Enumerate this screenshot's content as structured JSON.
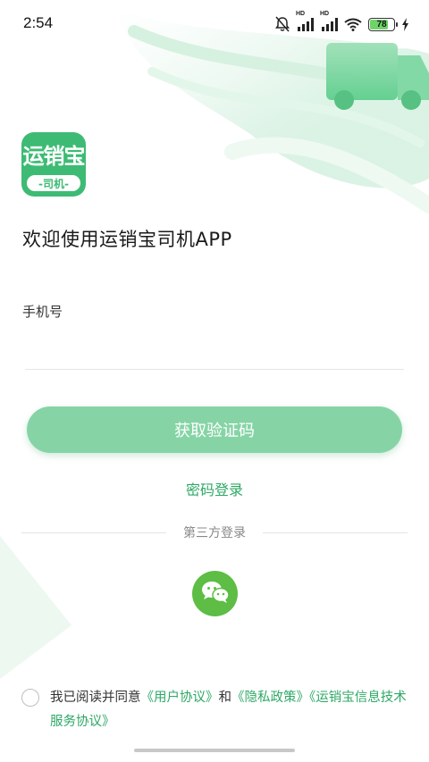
{
  "status_bar": {
    "time": "2:54",
    "battery_level": "78",
    "battery_percent": 78,
    "signal_1_label": "HD",
    "signal_2_label": "HD",
    "icons": [
      "mute-bell-icon",
      "signal-hd-icon",
      "signal-hd-icon",
      "wifi-icon",
      "battery-icon",
      "charging-icon"
    ]
  },
  "app": {
    "logo_text": "运销宝",
    "logo_sub": "-司机-"
  },
  "welcome": {
    "title": "欢迎使用运销宝司机APP"
  },
  "form": {
    "phone_label": "手机号",
    "phone_value": "",
    "phone_placeholder": "",
    "get_code_button": "获取验证码",
    "password_login": "密码登录"
  },
  "third_party": {
    "label": "第三方登录",
    "options": [
      "wechat-icon"
    ]
  },
  "agreement": {
    "prefix": "我已阅读并同意",
    "user_agreement": "《用户协议》",
    "and": "和",
    "privacy_policy": "《隐私政策》",
    "service_agreement": "《运销宝信息技术服务协议》"
  },
  "colors": {
    "brand_green": "#2ea866",
    "button_green": "#86d4a6",
    "logo_green": "#3dbb74",
    "wechat_green": "#5dbd45"
  }
}
